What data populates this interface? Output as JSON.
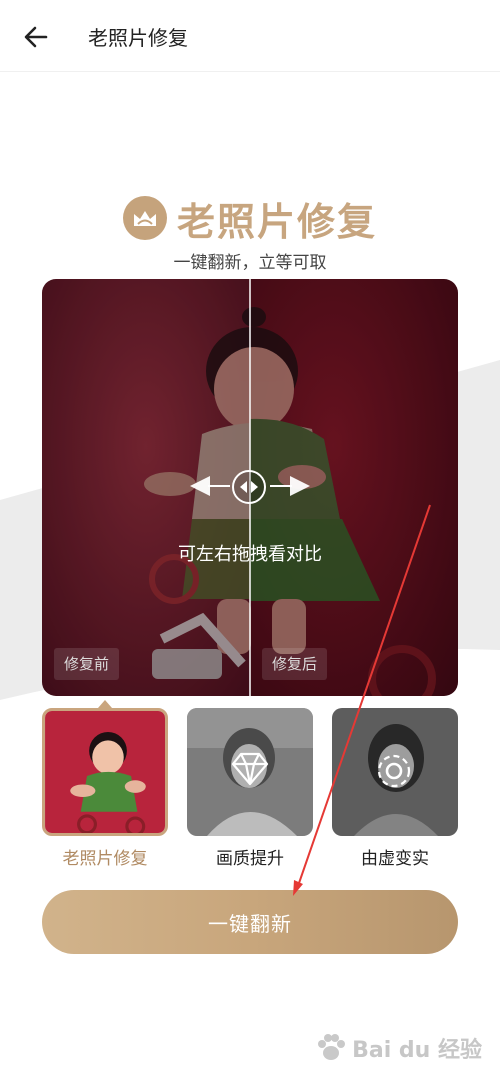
{
  "header": {
    "title": "老照片修复"
  },
  "hero": {
    "title": "老照片修复",
    "subtitle": "一键翻新，立等可取"
  },
  "compare": {
    "hint": "可左右拖拽看对比",
    "before_label": "修复前",
    "after_label": "修复后",
    "divider_position": 0.5
  },
  "tools": [
    {
      "label": "老照片修复",
      "selected": true
    },
    {
      "label": "画质提升",
      "selected": false
    },
    {
      "label": "由虚变实",
      "selected": false
    }
  ],
  "cta": {
    "label": "一键翻新"
  },
  "watermark": {
    "text": "Bai du 经验"
  },
  "colors": {
    "accent": "#c8a67c",
    "accent_text": "#b08a62",
    "photo_bg": "#6b1b2a",
    "annotation_arrow": "#e53935"
  }
}
